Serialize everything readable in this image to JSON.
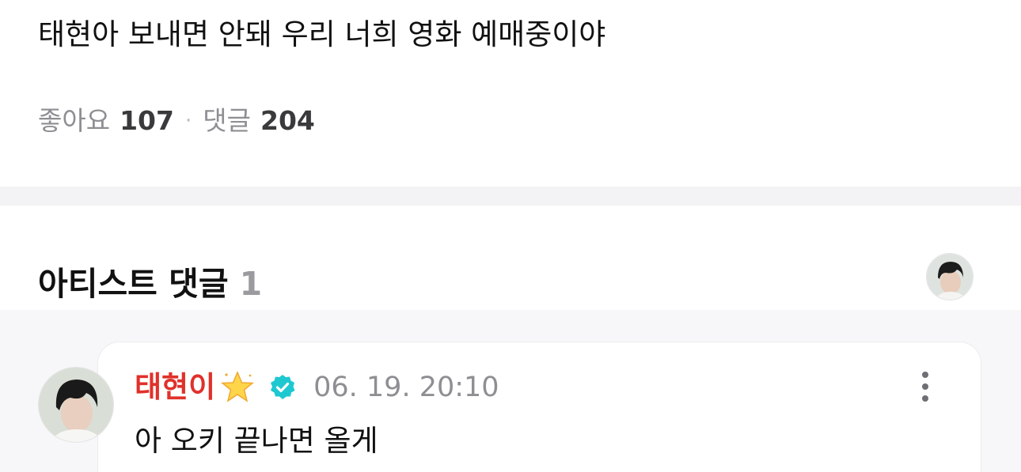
{
  "post": {
    "text": "태현아 보내면 안돼 우리 너희 영화 예매중이야"
  },
  "stats": {
    "likes_label": "좋아요",
    "likes_count": "107",
    "separator": "·",
    "comments_label": "댓글",
    "comments_count": "204"
  },
  "artist_comments": {
    "title": "아티스트 댓글",
    "count": "1",
    "header_avatar_icon": "artist-profile-avatar",
    "items": [
      {
        "author": "태현이",
        "badge_icon": "star-icon",
        "verified_icon": "verified-check-icon",
        "timestamp": "06. 19. 20:10",
        "text": "아 오키 끝나면 올게",
        "more_icon": "more-vertical-icon"
      }
    ]
  },
  "colors": {
    "author_name": "#e0312b",
    "verified": "#1ec8d0",
    "muted": "#8e8e93",
    "divider": "#f3f3f5"
  }
}
